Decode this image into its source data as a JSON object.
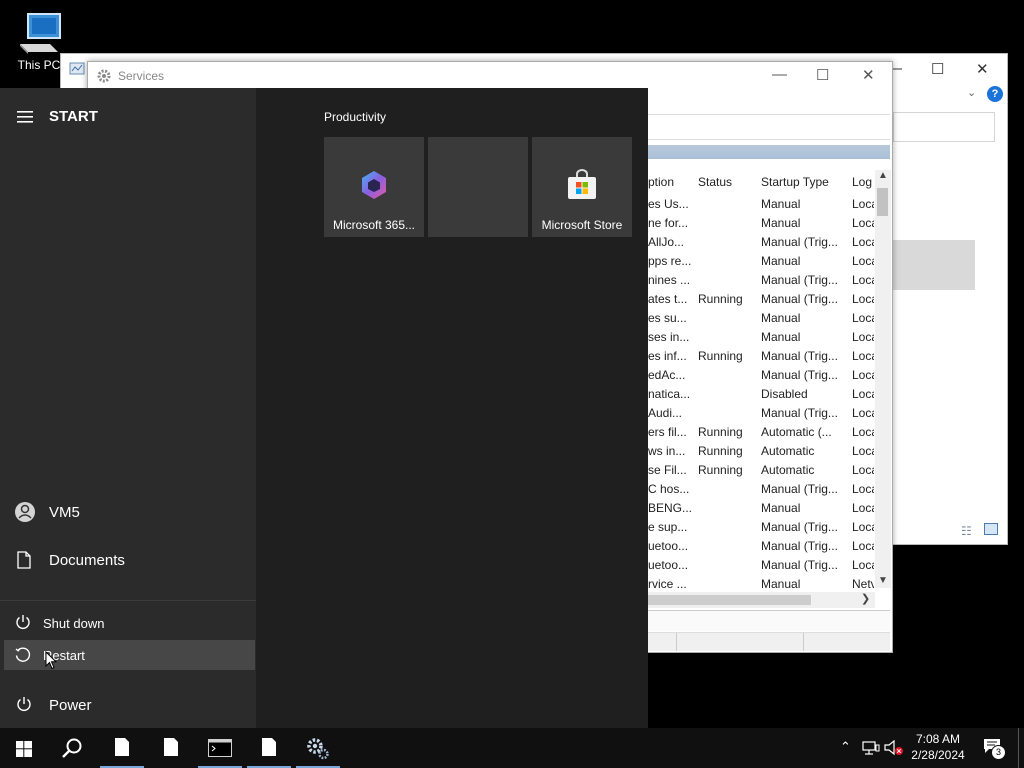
{
  "desktop": {
    "this_pc_label": "This PC"
  },
  "services_window": {
    "title": "Services",
    "columns": [
      "ption",
      "Status",
      "Startup Type",
      "Log"
    ],
    "rows": [
      [
        "es Us...",
        "",
        "Manual",
        "Loca"
      ],
      [
        "ne for...",
        "",
        "Manual",
        "Loca"
      ],
      [
        " AllJo...",
        "",
        "Manual (Trig...",
        "Loca"
      ],
      [
        "pps re...",
        "",
        "Manual",
        "Loca"
      ],
      [
        "nines ...",
        "",
        "Manual (Trig...",
        "Loca"
      ],
      [
        "ates t...",
        "Running",
        "Manual (Trig...",
        "Loca"
      ],
      [
        "es su...",
        "",
        "Manual",
        "Loca"
      ],
      [
        "ses in...",
        "",
        "Manual",
        "Loca"
      ],
      [
        "es inf...",
        "Running",
        "Manual (Trig...",
        "Loca"
      ],
      [
        "edAc...",
        "",
        "Manual (Trig...",
        "Loca"
      ],
      [
        "natica...",
        "",
        "Disabled",
        "Loca"
      ],
      [
        " Audi...",
        "",
        "Manual (Trig...",
        "Loca"
      ],
      [
        "ers fil...",
        "Running",
        "Automatic (...",
        "Loca"
      ],
      [
        "ws in...",
        "Running",
        "Automatic",
        "Loca"
      ],
      [
        "se Fil...",
        "Running",
        "Automatic",
        "Loca"
      ],
      [
        "C hos...",
        "",
        "Manual (Trig...",
        "Loca"
      ],
      [
        "BENG...",
        "",
        "Manual",
        "Loca"
      ],
      [
        "e sup...",
        "",
        "Manual (Trig...",
        "Loca"
      ],
      [
        "uetoo...",
        "",
        "Manual (Trig...",
        "Loca"
      ],
      [
        "uetoo...",
        "",
        "Manual (Trig...",
        "Loca"
      ],
      [
        "rvice ...",
        "",
        "Manual",
        "Netv"
      ]
    ]
  },
  "start_menu": {
    "header": "START",
    "user": "VM5",
    "documents": "Documents",
    "power_options": [
      "Shut down",
      "Restart"
    ],
    "power": "Power",
    "group_title": "Productivity",
    "tiles": [
      {
        "label": "Microsoft 365...",
        "icon": "m365-icon"
      },
      {
        "label": "",
        "icon": ""
      },
      {
        "label": "Microsoft Store",
        "icon": "store-icon"
      }
    ]
  },
  "taskbar": {
    "time": "7:08 AM",
    "date": "2/28/2024",
    "notification_count": "3",
    "accent": "#78a7d8"
  }
}
